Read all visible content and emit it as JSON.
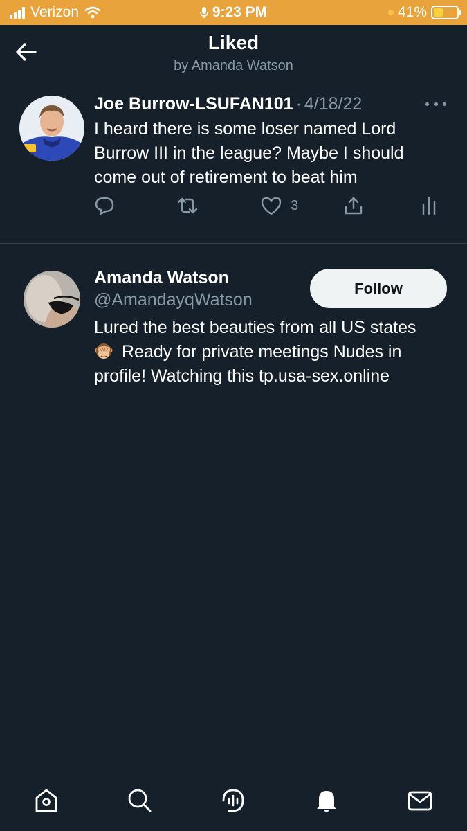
{
  "status_bar": {
    "carrier": "Verizon",
    "time": "9:23 PM",
    "battery_percent": "41%",
    "battery_level": 0.41,
    "bar_color": "#e8a33d"
  },
  "header": {
    "title": "Liked",
    "subtitle": "by Amanda Watson"
  },
  "tweet": {
    "author_name": "Joe Burrow-LSUFAN101",
    "separator": "·",
    "date": "4/18/22",
    "text": "I heard there is some loser named Lord Burrow III in the league? Maybe I should come out of retirement to beat him",
    "like_count": "3",
    "icons": [
      "reply-icon",
      "retweet-icon",
      "like-icon",
      "share-icon",
      "analytics-icon"
    ]
  },
  "profile": {
    "name": "Amanda Watson",
    "handle": "@AmandayqWatson",
    "follow_label": "Follow",
    "bio_line1": "Lured the best beauties from all US states",
    "bio_line2": "Ready for private meetings Nudes in",
    "bio_line3": "profile! Watching this tp.usa-sex.online"
  },
  "bottom_nav": {
    "items": [
      "home-icon",
      "search-icon",
      "spaces-icon",
      "notifications-icon",
      "messages-icon"
    ]
  },
  "colors": {
    "background": "#15202b",
    "secondary_text": "#8899a6",
    "divider": "#38444d",
    "follow_button_bg": "#eff3f4"
  }
}
